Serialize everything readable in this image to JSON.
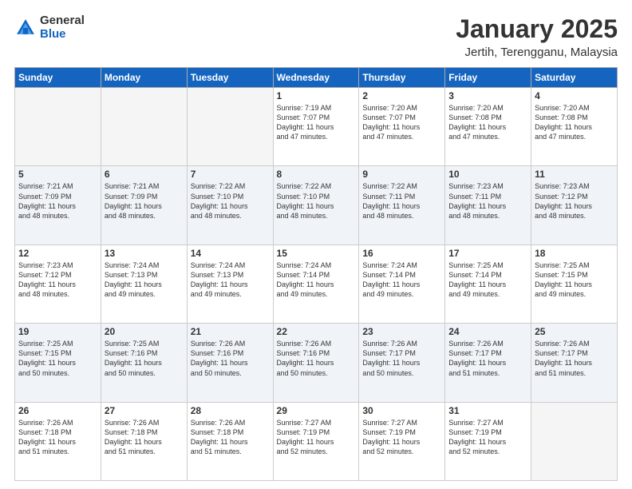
{
  "logo": {
    "general": "General",
    "blue": "Blue"
  },
  "header": {
    "title": "January 2025",
    "subtitle": "Jertih, Terengganu, Malaysia"
  },
  "weekdays": [
    "Sunday",
    "Monday",
    "Tuesday",
    "Wednesday",
    "Thursday",
    "Friday",
    "Saturday"
  ],
  "weeks": [
    [
      {
        "day": "",
        "info": ""
      },
      {
        "day": "",
        "info": ""
      },
      {
        "day": "",
        "info": ""
      },
      {
        "day": "1",
        "info": "Sunrise: 7:19 AM\nSunset: 7:07 PM\nDaylight: 11 hours\nand 47 minutes."
      },
      {
        "day": "2",
        "info": "Sunrise: 7:20 AM\nSunset: 7:07 PM\nDaylight: 11 hours\nand 47 minutes."
      },
      {
        "day": "3",
        "info": "Sunrise: 7:20 AM\nSunset: 7:08 PM\nDaylight: 11 hours\nand 47 minutes."
      },
      {
        "day": "4",
        "info": "Sunrise: 7:20 AM\nSunset: 7:08 PM\nDaylight: 11 hours\nand 47 minutes."
      }
    ],
    [
      {
        "day": "5",
        "info": "Sunrise: 7:21 AM\nSunset: 7:09 PM\nDaylight: 11 hours\nand 48 minutes."
      },
      {
        "day": "6",
        "info": "Sunrise: 7:21 AM\nSunset: 7:09 PM\nDaylight: 11 hours\nand 48 minutes."
      },
      {
        "day": "7",
        "info": "Sunrise: 7:22 AM\nSunset: 7:10 PM\nDaylight: 11 hours\nand 48 minutes."
      },
      {
        "day": "8",
        "info": "Sunrise: 7:22 AM\nSunset: 7:10 PM\nDaylight: 11 hours\nand 48 minutes."
      },
      {
        "day": "9",
        "info": "Sunrise: 7:22 AM\nSunset: 7:11 PM\nDaylight: 11 hours\nand 48 minutes."
      },
      {
        "day": "10",
        "info": "Sunrise: 7:23 AM\nSunset: 7:11 PM\nDaylight: 11 hours\nand 48 minutes."
      },
      {
        "day": "11",
        "info": "Sunrise: 7:23 AM\nSunset: 7:12 PM\nDaylight: 11 hours\nand 48 minutes."
      }
    ],
    [
      {
        "day": "12",
        "info": "Sunrise: 7:23 AM\nSunset: 7:12 PM\nDaylight: 11 hours\nand 48 minutes."
      },
      {
        "day": "13",
        "info": "Sunrise: 7:24 AM\nSunset: 7:13 PM\nDaylight: 11 hours\nand 49 minutes."
      },
      {
        "day": "14",
        "info": "Sunrise: 7:24 AM\nSunset: 7:13 PM\nDaylight: 11 hours\nand 49 minutes."
      },
      {
        "day": "15",
        "info": "Sunrise: 7:24 AM\nSunset: 7:14 PM\nDaylight: 11 hours\nand 49 minutes."
      },
      {
        "day": "16",
        "info": "Sunrise: 7:24 AM\nSunset: 7:14 PM\nDaylight: 11 hours\nand 49 minutes."
      },
      {
        "day": "17",
        "info": "Sunrise: 7:25 AM\nSunset: 7:14 PM\nDaylight: 11 hours\nand 49 minutes."
      },
      {
        "day": "18",
        "info": "Sunrise: 7:25 AM\nSunset: 7:15 PM\nDaylight: 11 hours\nand 49 minutes."
      }
    ],
    [
      {
        "day": "19",
        "info": "Sunrise: 7:25 AM\nSunset: 7:15 PM\nDaylight: 11 hours\nand 50 minutes."
      },
      {
        "day": "20",
        "info": "Sunrise: 7:25 AM\nSunset: 7:16 PM\nDaylight: 11 hours\nand 50 minutes."
      },
      {
        "day": "21",
        "info": "Sunrise: 7:26 AM\nSunset: 7:16 PM\nDaylight: 11 hours\nand 50 minutes."
      },
      {
        "day": "22",
        "info": "Sunrise: 7:26 AM\nSunset: 7:16 PM\nDaylight: 11 hours\nand 50 minutes."
      },
      {
        "day": "23",
        "info": "Sunrise: 7:26 AM\nSunset: 7:17 PM\nDaylight: 11 hours\nand 50 minutes."
      },
      {
        "day": "24",
        "info": "Sunrise: 7:26 AM\nSunset: 7:17 PM\nDaylight: 11 hours\nand 51 minutes."
      },
      {
        "day": "25",
        "info": "Sunrise: 7:26 AM\nSunset: 7:17 PM\nDaylight: 11 hours\nand 51 minutes."
      }
    ],
    [
      {
        "day": "26",
        "info": "Sunrise: 7:26 AM\nSunset: 7:18 PM\nDaylight: 11 hours\nand 51 minutes."
      },
      {
        "day": "27",
        "info": "Sunrise: 7:26 AM\nSunset: 7:18 PM\nDaylight: 11 hours\nand 51 minutes."
      },
      {
        "day": "28",
        "info": "Sunrise: 7:26 AM\nSunset: 7:18 PM\nDaylight: 11 hours\nand 51 minutes."
      },
      {
        "day": "29",
        "info": "Sunrise: 7:27 AM\nSunset: 7:19 PM\nDaylight: 11 hours\nand 52 minutes."
      },
      {
        "day": "30",
        "info": "Sunrise: 7:27 AM\nSunset: 7:19 PM\nDaylight: 11 hours\nand 52 minutes."
      },
      {
        "day": "31",
        "info": "Sunrise: 7:27 AM\nSunset: 7:19 PM\nDaylight: 11 hours\nand 52 minutes."
      },
      {
        "day": "",
        "info": ""
      }
    ]
  ]
}
